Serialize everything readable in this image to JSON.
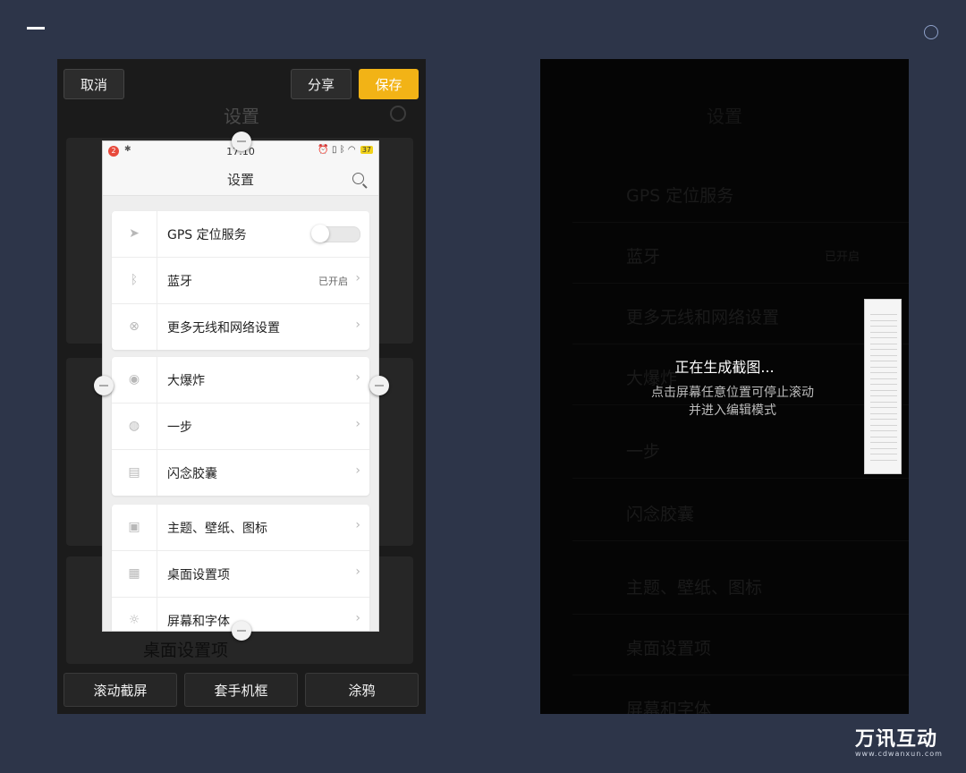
{
  "left_phone": {
    "top_bar": {
      "cancel_label": "取消",
      "share_label": "分享",
      "save_label": "保存"
    },
    "background": {
      "title": "设置",
      "row_label": "桌面设置项"
    },
    "screenshot": {
      "status_bar": {
        "notification_count": "2",
        "time": "17:10",
        "battery": "37"
      },
      "nav_title": "设置",
      "groups": [
        {
          "rows": [
            {
              "label": "GPS 定位服务",
              "icon": "location-arrow-icon",
              "glyph": "➤",
              "toggle": true
            },
            {
              "label": "蓝牙",
              "icon": "bluetooth-icon",
              "glyph": "ᛒ",
              "value": "已开启"
            },
            {
              "label": "更多无线和网络设置",
              "icon": "network-icon",
              "glyph": "⊗"
            }
          ]
        },
        {
          "rows": [
            {
              "label": "大爆炸",
              "icon": "big-bang-icon",
              "glyph": "◉"
            },
            {
              "label": "一步",
              "icon": "one-step-icon",
              "glyph": "◍"
            },
            {
              "label": "闪念胶囊",
              "icon": "capsule-icon",
              "glyph": "▤"
            }
          ]
        },
        {
          "rows": [
            {
              "label": "主题、壁纸、图标",
              "icon": "theme-icon",
              "glyph": "▣"
            },
            {
              "label": "桌面设置项",
              "icon": "desktop-grid-icon",
              "glyph": "▦"
            },
            {
              "label": "屏幕和字体",
              "icon": "brightness-icon",
              "glyph": "☼"
            }
          ]
        }
      ]
    },
    "bottom_bar": {
      "scroll_label": "滚动截屏",
      "frame_label": "套手机框",
      "doodle_label": "涂鸦"
    }
  },
  "right_phone": {
    "title": "设置",
    "dim_items": [
      "GPS 定位服务",
      "蓝牙",
      "更多无线和网络设置",
      "大爆炸",
      "一步",
      "闪念胶囊",
      "主题、壁纸、图标",
      "桌面设置项",
      "屏幕和字体"
    ],
    "bluetooth_value": "已开启",
    "generating_text": "正在生成截图...",
    "hint_line1": "点击屏幕任意位置可停止滚动",
    "hint_line2": "并进入编辑模式"
  },
  "brand": {
    "logo_text": "万讯互动",
    "logo_url_text": "www.cdwanxun.com"
  },
  "colors": {
    "background": "#2d3549",
    "save_button": "#f2b316",
    "battery": "#f1d21a"
  }
}
